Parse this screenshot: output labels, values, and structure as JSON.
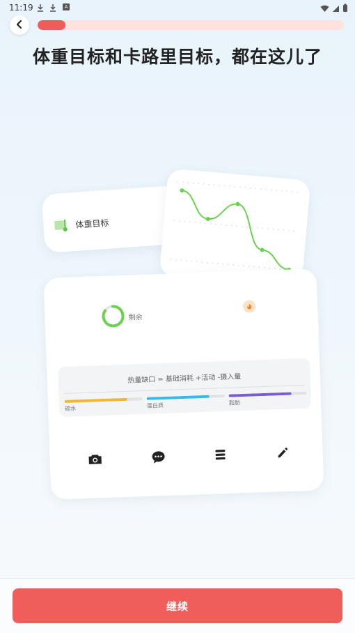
{
  "status_bar": {
    "time": "11:19",
    "icons": [
      "download-icon",
      "download-icon",
      "app-a-icon",
      "wifi-icon",
      "signal-icon",
      "battery-icon"
    ],
    "app_icon_text": "A"
  },
  "header": {
    "progress_fraction": 0.09,
    "title": "体重目标和卡路里目标，都在这儿了"
  },
  "weight_card": {
    "label": "体重目标"
  },
  "trend_chart": {
    "type": "line",
    "values": [
      48,
      30,
      42,
      12,
      0
    ],
    "color": "#6bd14f"
  },
  "calorie_card": {
    "remaining_label": "剩余",
    "ring_fraction": 0.85,
    "formula": "热量缺口 = 基础消耗 +活动 -摄入量",
    "macros": [
      {
        "label": "碳水",
        "fraction": 0.8,
        "color": "#f2b632"
      },
      {
        "label": "蛋白质",
        "fraction": 0.8,
        "color": "#36b9ee"
      },
      {
        "label": "脂肪",
        "fraction": 0.8,
        "color": "#7c5bd6"
      }
    ]
  },
  "toolbar": {
    "tools": [
      "camera-icon",
      "chat-bubble-icon",
      "list-icon",
      "edit-pencil-icon"
    ]
  },
  "footer": {
    "continue_label": "继续"
  },
  "colors": {
    "accent": "#f05e5c",
    "progress_track": "#fde2de",
    "green": "#6bd14f"
  }
}
